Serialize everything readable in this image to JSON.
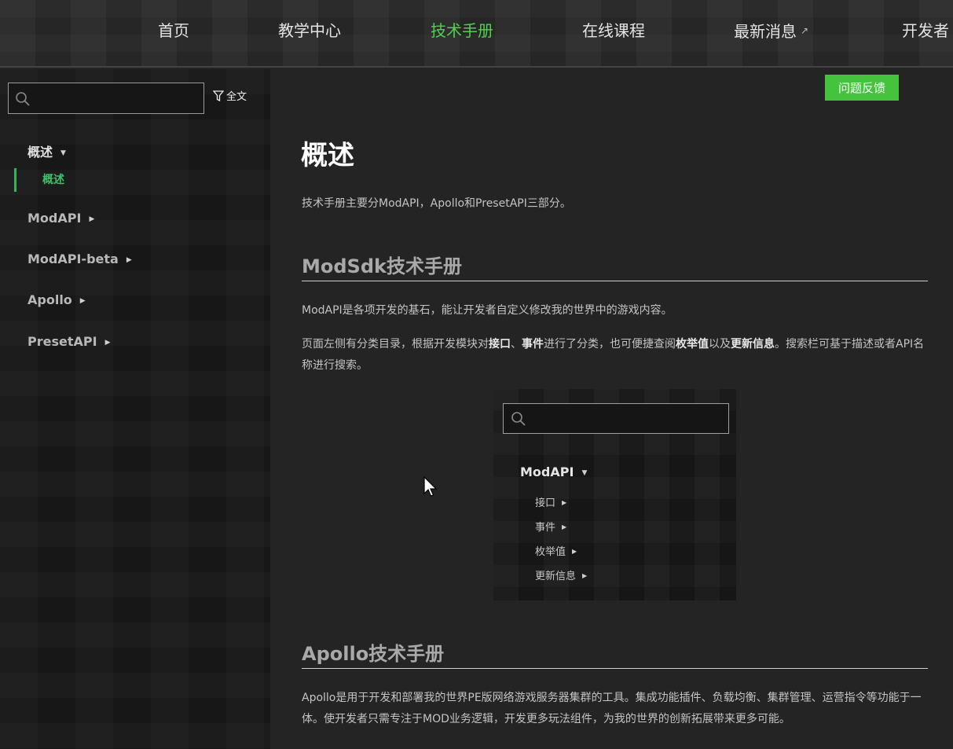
{
  "nav": {
    "items": [
      {
        "label": "首页",
        "active": false,
        "external": false
      },
      {
        "label": "教学中心",
        "active": false,
        "external": false
      },
      {
        "label": "技术手册",
        "active": true,
        "external": false
      },
      {
        "label": "在线课程",
        "active": false,
        "external": false
      },
      {
        "label": "最新消息",
        "active": false,
        "external": true
      },
      {
        "label": "开发者",
        "active": false,
        "external": false
      }
    ],
    "active_color": "#4fd24d"
  },
  "sidebar": {
    "search": {
      "placeholder": "",
      "value": ""
    },
    "filter_label": "全文",
    "items": [
      {
        "label": "概述",
        "expanded": true
      },
      {
        "label": "ModAPI",
        "expanded": false
      },
      {
        "label": "ModAPI-beta",
        "expanded": false
      },
      {
        "label": "Apollo",
        "expanded": false
      },
      {
        "label": "PresetAPI",
        "expanded": false
      }
    ],
    "active_sub": "概述",
    "accent_color": "#35b35a"
  },
  "main": {
    "feedback_label": "问题反馈",
    "title": "概述",
    "intro": "技术手册主要分ModAPI，Apollo和PresetAPI三部分。",
    "modsdk": {
      "heading": "ModSdk技术手册",
      "p1": "ModAPI是各项开发的基石，能让开发者自定义修改我的世界中的游戏内容。",
      "p2": {
        "t1": "页面左侧有分类目录，根据开发模块对",
        "b1": "接口",
        "t2": "、",
        "b2": "事件",
        "t3": "进行了分类，也可便捷查阅",
        "b3": "枚举值",
        "t4": "以及",
        "b4": "更新信息",
        "t5": "。搜索栏可基于描述或者API名称进行搜索。"
      },
      "preview": {
        "head": "ModAPI",
        "items": [
          "接口",
          "事件",
          "枚举值",
          "更新信息"
        ]
      }
    },
    "apollo": {
      "heading": "Apollo技术手册",
      "p1": "Apollo是用于开发和部署我的世界PE版网络游戏服务器集群的工具。集成功能插件、负载均衡、集群管理、运营指令等功能于一体。使开发者只需专注于MOD业务逻辑，开发更多玩法组件，为我的世界的创新拓展带来更多可能。"
    }
  },
  "icons": {
    "search": "search-icon",
    "filter": "filter-icon",
    "external": "external-link-icon",
    "caret_down": "caret-down-icon",
    "caret_right": "caret-right-icon"
  }
}
